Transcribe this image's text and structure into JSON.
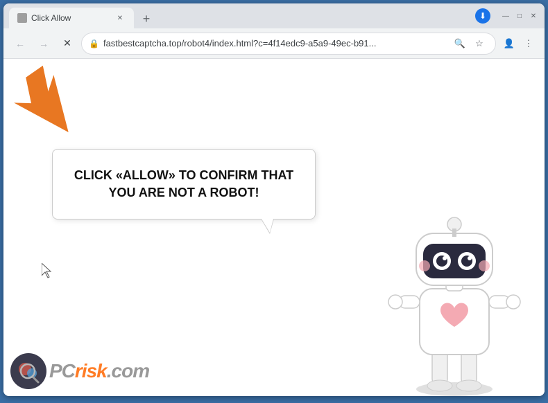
{
  "browser": {
    "tab": {
      "title": "Click Allow",
      "favicon": "🔒"
    },
    "window_controls": {
      "minimize": "—",
      "maximize": "□",
      "close": "✕"
    },
    "toolbar": {
      "back_label": "←",
      "forward_label": "→",
      "reload_label": "✕",
      "url": "fastbestcaptcha.top/robot4/index.html?c=4f14edc9-a5a9-49ec-b91...",
      "search_icon": "🔍",
      "bookmark_icon": "☆",
      "profile_icon": "👤",
      "menu_icon": "⋮",
      "download_icon": "⬇"
    },
    "new_tab_label": "+"
  },
  "page": {
    "message": "CLICK «ALLOW» TO CONFIRM THAT YOU ARE NOT A ROBOT!",
    "arrow_color": "#e87722"
  },
  "watermark": {
    "site": "PCrisk.com",
    "site_colored": "risk",
    "pc_part": "PC"
  }
}
